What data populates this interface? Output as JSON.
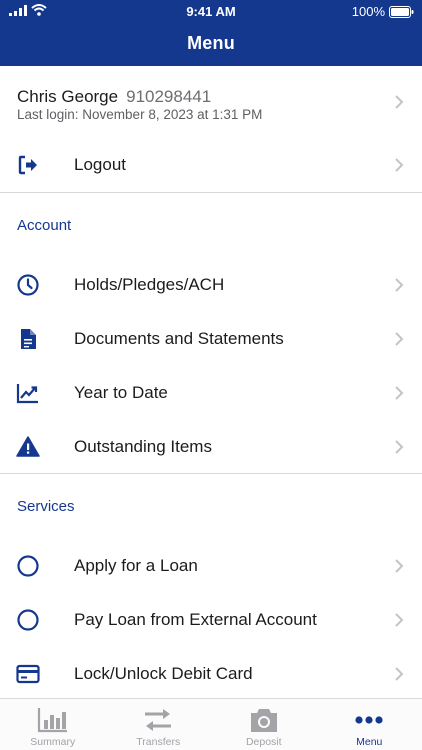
{
  "status": {
    "time": "9:41 AM",
    "battery": "100%"
  },
  "header": {
    "title": "Menu"
  },
  "profile": {
    "name": "Chris George",
    "account": "910298441",
    "last_login": "Last login: November 8, 2023 at 1:31 PM"
  },
  "logout": {
    "label": "Logout",
    "icon": "logout-icon"
  },
  "account_section": {
    "title": "Account",
    "items": [
      {
        "label": "Holds/Pledges/ACH",
        "icon": "clock-icon"
      },
      {
        "label": "Documents and Statements",
        "icon": "document-icon"
      },
      {
        "label": "Year to Date",
        "icon": "trend-chart-icon"
      },
      {
        "label": "Outstanding Items",
        "icon": "warning-icon"
      }
    ]
  },
  "services_section": {
    "title": "Services",
    "items": [
      {
        "label": "Apply for a Loan",
        "icon": "circle-icon"
      },
      {
        "label": "Pay Loan from External Account",
        "icon": "circle-icon"
      },
      {
        "label": "Lock/Unlock Debit Card",
        "icon": "credit-card-icon"
      }
    ]
  },
  "tabs": [
    {
      "label": "Summary",
      "icon": "bar-chart-icon",
      "active": false
    },
    {
      "label": "Transfers",
      "icon": "transfer-arrows-icon",
      "active": false
    },
    {
      "label": "Deposit",
      "icon": "camera-icon",
      "active": false
    },
    {
      "label": "Menu",
      "icon": "more-dots-icon",
      "active": true
    }
  ],
  "colors": {
    "brand": "#15388f",
    "inactive_tab": "#a3a3a8",
    "divider": "#d7d7dc"
  }
}
